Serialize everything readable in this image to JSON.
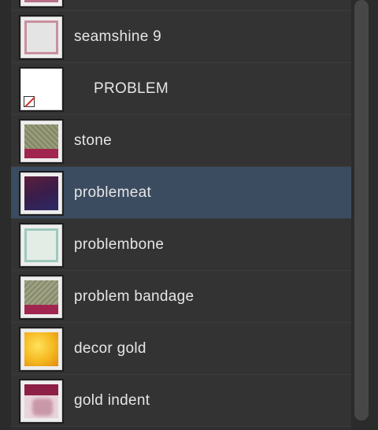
{
  "materials": [
    {
      "label": "",
      "thumb": "frame-texture"
    },
    {
      "label": "seamshine 9",
      "thumb": "seam-texture"
    },
    {
      "label": "PROBLEM",
      "thumb": "missing-texture"
    },
    {
      "label": "stone",
      "thumb": "stone-texture"
    },
    {
      "label": "problemeat",
      "thumb": "meat-texture"
    },
    {
      "label": "problembone",
      "thumb": "bone-texture"
    },
    {
      "label": "problem bandage",
      "thumb": "bandage-texture"
    },
    {
      "label": "decor gold",
      "thumb": "gold-texture"
    },
    {
      "label": "gold indent",
      "thumb": "gold-indent-texture"
    }
  ],
  "selected": "problemeat",
  "colors": {
    "selected_row": "#3b4b60",
    "row": "#333333",
    "text": "#e6e6e6"
  }
}
